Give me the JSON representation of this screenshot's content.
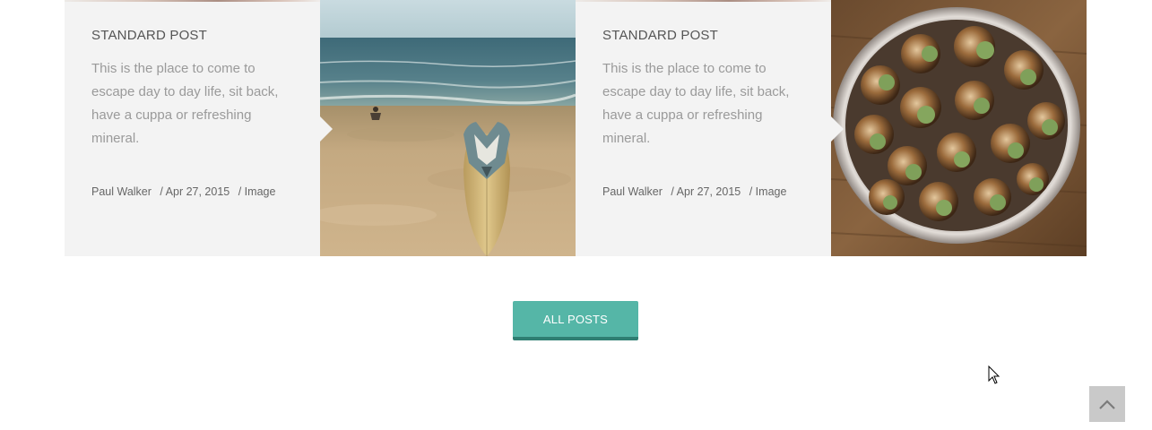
{
  "posts": [
    {
      "title": "STANDARD POST",
      "excerpt": "This is the place to come to escape day to day life, sit back, have a cuppa or refreshing mineral.",
      "author": "Paul Walker",
      "date": "/ Apr 27, 2015",
      "category": "/ Image",
      "image": "surfboard-on-beach"
    },
    {
      "title": "STANDARD POST",
      "excerpt": "This is the place to come to escape day to day life, sit back, have a cuppa or refreshing mineral.",
      "author": "Paul Walker",
      "date": "/ Apr 27, 2015",
      "category": "/ Image",
      "image": "snails-in-tin-dish"
    }
  ],
  "all_posts": {
    "label": "ALL POSTS"
  },
  "back_to_top": {
    "icon": "chevron-up-icon"
  },
  "colors": {
    "card_bg": "#f3f3f3",
    "accent": "#55b6a7",
    "accent_dark": "#2f7e72",
    "title": "#555555",
    "excerpt": "#9a9a9a"
  }
}
